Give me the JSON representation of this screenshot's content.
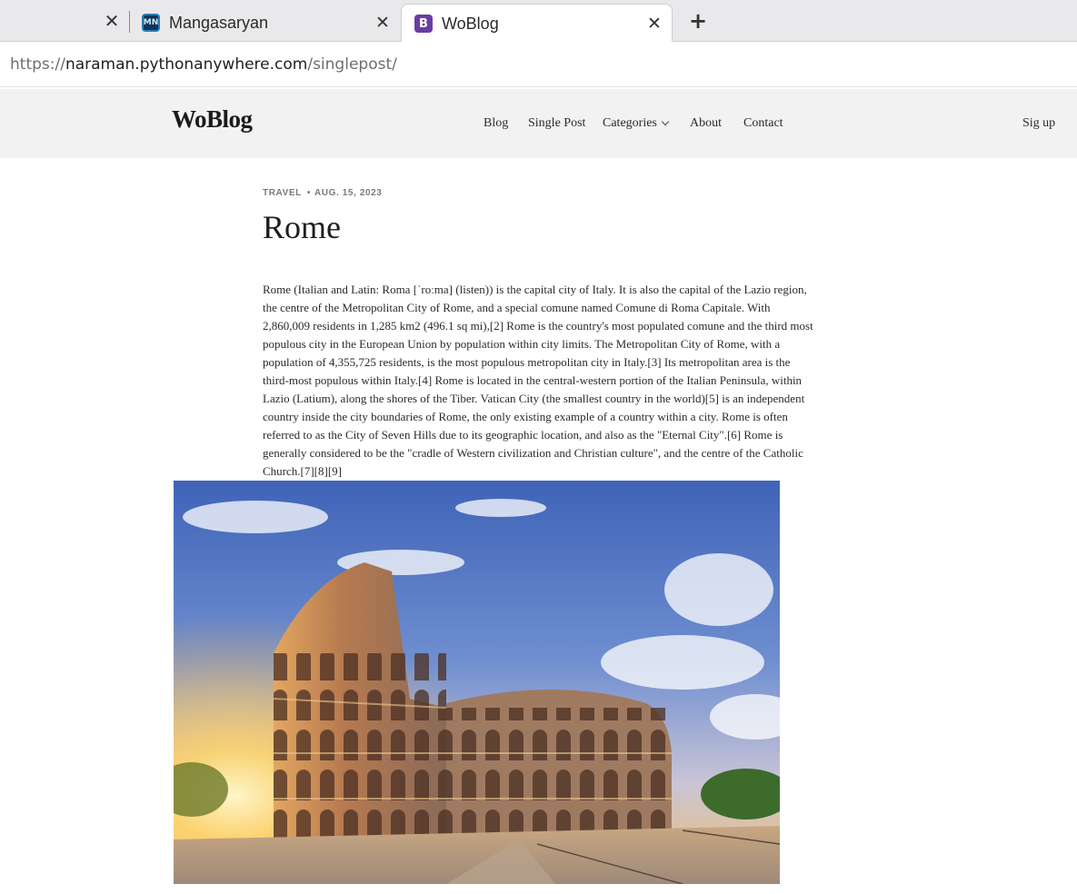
{
  "browser": {
    "tabs": [
      {
        "title": "Mangasaryan",
        "favicon": "mn-logo-icon",
        "active": false
      },
      {
        "title": "WoBlog",
        "favicon": "bootstrap-b-icon",
        "active": true
      }
    ],
    "url": {
      "scheme": "https://",
      "host": "naraman.pythonanywhere.com",
      "path": "/singlepost/"
    }
  },
  "site": {
    "logo": "WoBlog",
    "nav": {
      "blog": "Blog",
      "single_post": "Single Post",
      "categories": "Categories",
      "about": "About",
      "contact": "Contact",
      "signup": "Sig up"
    }
  },
  "post": {
    "category": "TRAVEL",
    "date": "AUG. 15, 2023",
    "title": "Rome",
    "body": "Rome (Italian and Latin: Roma [ˈroːma] (listen)) is the capital city of Italy. It is also the capital of the Lazio region, the centre of the Metropolitan City of Rome, and a special comune named Comune di Roma Capitale. With 2,860,009 residents in 1,285 km2 (496.1 sq mi),[2] Rome is the country's most populated comune and the third most populous city in the European Union by population within city limits. The Metropolitan City of Rome, with a population of 4,355,725 residents, is the most populous metropolitan city in Italy.[3] Its metropolitan area is the third-most populous within Italy.[4] Rome is located in the central-western portion of the Italian Peninsula, within Lazio (Latium), along the shores of the Tiber. Vatican City (the smallest country in the world)[5] is an independent country inside the city boundaries of Rome, the only existing example of a country within a city. Rome is often referred to as the City of Seven Hills due to its geographic location, and also as the \"Eternal City\".[6] Rome is generally considered to be the \"cradle of Western civilization and Christian culture\", and the centre of the Catholic Church.[7][8][9]"
  },
  "colors": {
    "header_bg": "#f2f2f2",
    "tabbar_bg": "#e9e9eb",
    "favicon_b": "#6a3ea1",
    "text": "#212529"
  }
}
